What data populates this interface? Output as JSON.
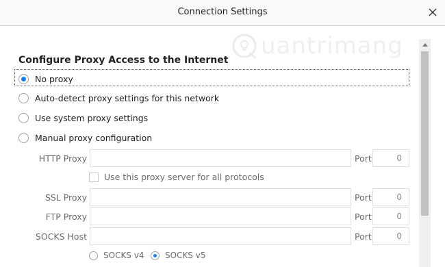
{
  "window": {
    "title": "Connection Settings",
    "close_icon": "close-icon"
  },
  "watermark": {
    "text": "uantrimang",
    "icon": "lightbulb-q-icon"
  },
  "section": {
    "heading": "Configure Proxy Access to the Internet"
  },
  "proxy_options": [
    {
      "label": "No proxy",
      "checked": true
    },
    {
      "label": "Auto-detect proxy settings for this network",
      "checked": false
    },
    {
      "label": "Use system proxy settings",
      "checked": false
    },
    {
      "label": "Manual proxy configuration",
      "checked": false
    }
  ],
  "manual": {
    "http": {
      "label": "HTTP Proxy",
      "value": "",
      "port_label": "Port",
      "port": "0"
    },
    "use_for_all": {
      "label": "Use this proxy server for all protocols",
      "checked": false
    },
    "ssl": {
      "label": "SSL Proxy",
      "value": "",
      "port_label": "Port",
      "port": "0"
    },
    "ftp": {
      "label": "FTP Proxy",
      "value": "",
      "port_label": "Port",
      "port": "0"
    },
    "socks": {
      "label": "SOCKS Host",
      "value": "",
      "port_label": "Port",
      "port": "0"
    },
    "socks_versions": [
      {
        "label": "SOCKS v4",
        "checked": false
      },
      {
        "label": "SOCKS v5",
        "checked": true
      }
    ]
  },
  "colors": {
    "accent": "#0a84ff",
    "titlebar_bg": "#f9f9fa",
    "border": "#d7d7db"
  }
}
